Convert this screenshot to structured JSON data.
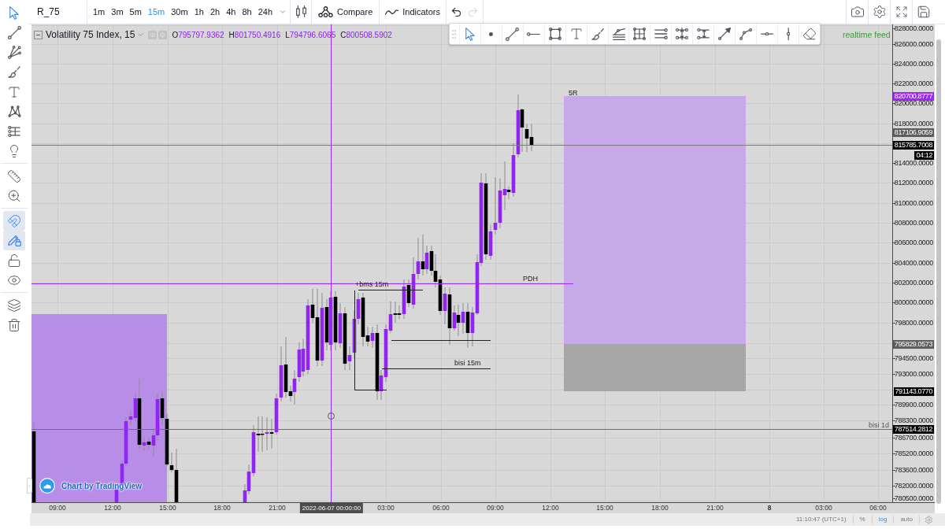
{
  "toolbar": {
    "symbol": "R_75",
    "intervals": [
      {
        "label": "1m",
        "selected": false
      },
      {
        "label": "3m",
        "selected": false
      },
      {
        "label": "5m",
        "selected": false
      },
      {
        "label": "15m",
        "selected": true
      },
      {
        "label": "30m",
        "selected": false
      },
      {
        "label": "1h",
        "selected": false
      },
      {
        "label": "2h",
        "selected": false
      },
      {
        "label": "4h",
        "selected": false
      },
      {
        "label": "8h",
        "selected": false
      },
      {
        "label": "24h",
        "selected": false
      }
    ],
    "compare": "Compare",
    "indicators": "Indicators",
    "history": [
      {
        "kind": "undo",
        "disabled": false
      },
      {
        "kind": "redo",
        "disabled": true
      }
    ]
  },
  "left_toolbar": {
    "tools": [
      {
        "kind": "cursor",
        "selected": true
      },
      {
        "kind": "trend-line",
        "selected": false
      },
      {
        "kind": "fan",
        "selected": false
      },
      {
        "kind": "brush",
        "selected": false
      },
      {
        "kind": "text",
        "selected": false
      },
      {
        "kind": "pattern",
        "selected": false
      },
      {
        "kind": "levels",
        "selected": false
      },
      {
        "kind": "idea",
        "selected": false
      }
    ],
    "measure": [
      {
        "kind": "ruler",
        "selected": false
      },
      {
        "kind": "zoom",
        "selected": false
      }
    ],
    "toggles": [
      {
        "kind": "magnet",
        "on": true
      },
      {
        "kind": "drawing-lock",
        "on": true
      },
      {
        "kind": "lock",
        "on": false
      },
      {
        "kind": "visibility",
        "on": false
      }
    ],
    "actions": [
      {
        "kind": "layers"
      },
      {
        "kind": "trash"
      }
    ]
  },
  "drawing_toolbar": {
    "tools": [
      {
        "kind": "cursor",
        "selected": true
      },
      {
        "kind": "dot",
        "selected": false
      },
      {
        "kind": "trend-line",
        "selected": false
      },
      {
        "kind": "horizontal-ray",
        "selected": false
      },
      {
        "kind": "rectangle",
        "selected": false
      },
      {
        "kind": "text",
        "selected": false
      },
      {
        "kind": "brush",
        "selected": false
      },
      {
        "kind": "fib-retracement",
        "selected": false
      },
      {
        "kind": "fib-box",
        "selected": false
      },
      {
        "kind": "parallel-lines",
        "selected": false
      },
      {
        "kind": "date-range",
        "selected": false
      },
      {
        "kind": "price-range",
        "selected": false
      },
      {
        "kind": "arrow",
        "selected": false
      },
      {
        "kind": "path",
        "selected": false
      },
      {
        "kind": "horizontal-segment",
        "selected": false
      },
      {
        "kind": "vertical-segment",
        "selected": false
      },
      {
        "kind": "eraser",
        "selected": false
      }
    ]
  },
  "legend": {
    "title": "Volatility 75 Index, 15",
    "values": [
      {
        "key": "O",
        "value": "795797.9362"
      },
      {
        "key": "H",
        "value": "801750.4916"
      },
      {
        "key": "L",
        "value": "794796.6065"
      },
      {
        "key": "C",
        "value": "800508.5902"
      }
    ]
  },
  "feed_status": "realtime feed",
  "chart_labels": [
    "5R",
    "PDH",
    "+bms 15m",
    "bisi 15m",
    "bisi 1d"
  ],
  "attribution": "Chart by TradingView",
  "price_axis": {
    "ticks": [
      "828000.0000",
      "826000.0000",
      "824000.0000",
      "822000.0000",
      "820000.0000",
      "818000.0000",
      "814000.0000",
      "812000.0000",
      "810000.0000",
      "808000.0000",
      "806000.0000",
      "804000.0000",
      "802000.0000",
      "800000.0000",
      "798000.0000",
      "794500.0000",
      "793000.0000",
      "789900.0000",
      "788300.0000",
      "786700.0000",
      "785200.0000",
      "783600.0000",
      "782000.0000",
      "780500.0000"
    ],
    "tags": [
      {
        "text": "820700.8777",
        "color": "#9c27f8"
      },
      {
        "text": "817106.9059",
        "color": "#5d5d5d"
      },
      {
        "text": "815785.7008",
        "color": "#000000"
      },
      {
        "text": "04:12",
        "color": "#000000"
      },
      {
        "text": "795829.0573",
        "color": "#5d5d5d"
      },
      {
        "text": "791143.0770",
        "color": "#000000"
      },
      {
        "text": "787514.2812",
        "color": "#000000"
      }
    ]
  },
  "time_axis": {
    "ticks": [
      {
        "text": "09:00",
        "kind": "time"
      },
      {
        "text": "12:00",
        "kind": "time"
      },
      {
        "text": "15:00",
        "kind": "time"
      },
      {
        "text": "18:00",
        "kind": "time"
      },
      {
        "text": "21:00",
        "kind": "time"
      },
      {
        "text": "03:00",
        "kind": "time"
      },
      {
        "text": "06:00",
        "kind": "time"
      },
      {
        "text": "09:00",
        "kind": "time"
      },
      {
        "text": "12:00",
        "kind": "time"
      },
      {
        "text": "15:00",
        "kind": "time"
      },
      {
        "text": "18:00",
        "kind": "time"
      },
      {
        "text": "21:00",
        "kind": "time"
      },
      {
        "text": "8",
        "kind": "day"
      },
      {
        "text": "03:00",
        "kind": "time"
      },
      {
        "text": "06:00",
        "kind": "time"
      }
    ],
    "crosshair_label": "2022-06-07 00:00:00"
  },
  "status_bar": {
    "time": "11:10:47 (UTC+1)",
    "options": [
      {
        "label": "%",
        "selected": false
      },
      {
        "label": "log",
        "selected": true
      },
      {
        "label": "auto",
        "selected": false
      }
    ]
  }
}
